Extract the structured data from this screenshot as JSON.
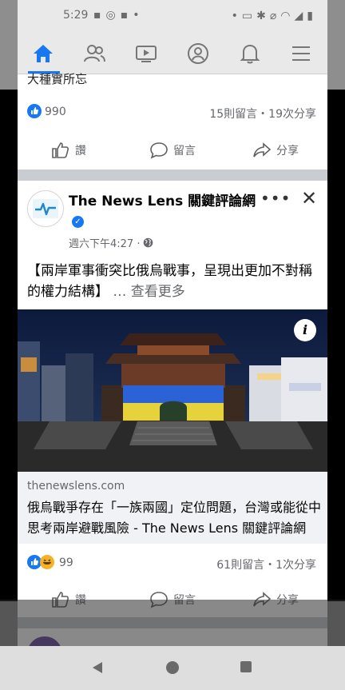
{
  "status_bar": {
    "time": "5:29"
  },
  "nav": {
    "tabs": [
      "home",
      "friends",
      "watch",
      "profile",
      "notifications",
      "menu"
    ],
    "active_tab": "home",
    "accent": "#1877f2"
  },
  "previous_post": {
    "text_tail": "大種實所忘",
    "reaction_count": "990",
    "stats": "15則留言・19次分享",
    "actions": {
      "like": "讚",
      "comment": "留言",
      "share": "分享"
    }
  },
  "post": {
    "author": "The News Lens 關鍵評論網",
    "time": "週六下午4:27 ·",
    "text": "【兩岸軍事衝突比俄烏戰事，呈現出更加不對稱的權力結構】",
    "see_more": "… 查看更多",
    "link": {
      "domain": "thenewslens.com",
      "title": "俄烏戰爭存在「一族兩國」定位問題，台灣或能從中思考兩岸避戰風險 - The News Lens 關鍵評論網"
    },
    "reaction_count": "99",
    "stats": "61則留言・1次分享",
    "actions": {
      "like": "讚",
      "comment": "留言",
      "share": "分享"
    }
  }
}
